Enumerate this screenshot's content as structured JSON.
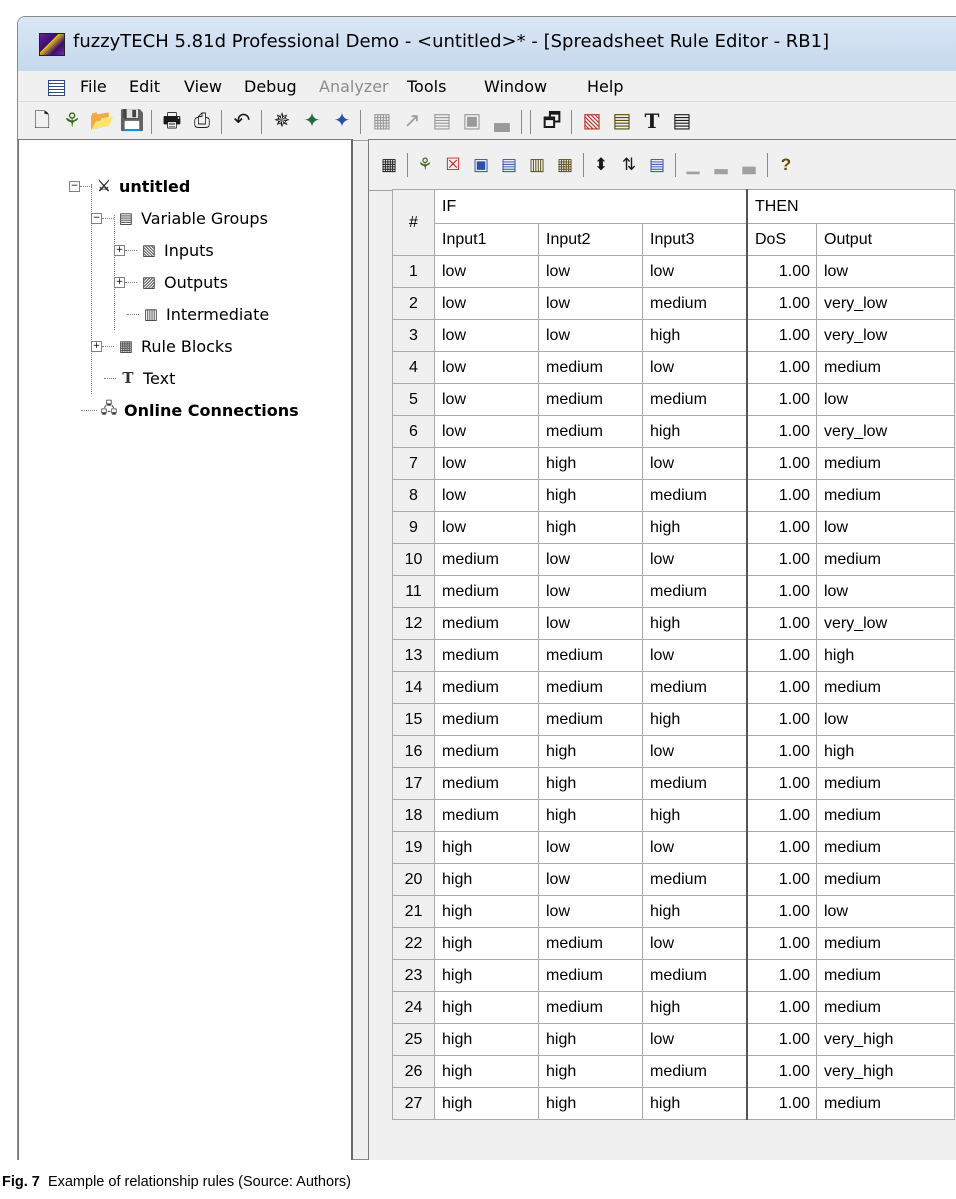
{
  "window": {
    "title": "fuzzyTECH 5.81d Professional Demo - <untitled>* - [Spreadsheet Rule Editor - RB1]"
  },
  "menu": {
    "items": [
      {
        "label": "File",
        "enabled": true
      },
      {
        "label": "Edit",
        "enabled": true
      },
      {
        "label": "View",
        "enabled": true
      },
      {
        "label": "Debug",
        "enabled": true
      },
      {
        "label": "Analyzer",
        "enabled": false
      },
      {
        "label": "Tools",
        "enabled": true
      },
      {
        "label": "Window",
        "enabled": true
      },
      {
        "label": "Help",
        "enabled": true
      }
    ]
  },
  "toolbar": {
    "icons": [
      "new-icon",
      "wizard-icon",
      "open-icon",
      "save-icon",
      "print-icon",
      "print-setup-icon",
      "undo-icon",
      "debug-icon",
      "debug-step-icon",
      "debug-run-icon",
      "analyzer-1-icon",
      "analyzer-2-icon",
      "analyzer-3-icon",
      "analyzer-4-icon",
      "analyzer-5-icon",
      "properties-icon",
      "edit-variable-icon",
      "edit-rules-icon",
      "text-icon",
      "window-icon"
    ]
  },
  "tree": {
    "root": "untitled",
    "variable_groups": "Variable Groups",
    "inputs": "Inputs",
    "outputs": "Outputs",
    "intermediate": "Intermediate",
    "rule_blocks": "Rule Blocks",
    "text": "Text",
    "online_connections": "Online Connections"
  },
  "rule_toolbar": {
    "icons": [
      "rule-block-icon",
      "wizard-icon",
      "delete-rule-icon",
      "dos-icon",
      "new-rule-icon",
      "insert-rule-icon",
      "sort-icon",
      "sort-order-icon",
      "matrix-icon",
      "chart-1-icon",
      "chart-2-icon",
      "chart-3-icon",
      "help-icon"
    ]
  },
  "rules_table": {
    "header_num": "#",
    "if_label": "IF",
    "then_label": "THEN",
    "columns": {
      "input1": "Input1",
      "input2": "Input2",
      "input3": "Input3",
      "dos": "DoS",
      "output": "Output"
    },
    "rows": [
      {
        "n": "1",
        "i1": "low",
        "i2": "low",
        "i3": "low",
        "dos": "1.00",
        "out": "low"
      },
      {
        "n": "2",
        "i1": "low",
        "i2": "low",
        "i3": "medium",
        "dos": "1.00",
        "out": "very_low"
      },
      {
        "n": "3",
        "i1": "low",
        "i2": "low",
        "i3": "high",
        "dos": "1.00",
        "out": "very_low"
      },
      {
        "n": "4",
        "i1": "low",
        "i2": "medium",
        "i3": "low",
        "dos": "1.00",
        "out": "medium"
      },
      {
        "n": "5",
        "i1": "low",
        "i2": "medium",
        "i3": "medium",
        "dos": "1.00",
        "out": "low"
      },
      {
        "n": "6",
        "i1": "low",
        "i2": "medium",
        "i3": "high",
        "dos": "1.00",
        "out": "very_low"
      },
      {
        "n": "7",
        "i1": "low",
        "i2": "high",
        "i3": "low",
        "dos": "1.00",
        "out": "medium"
      },
      {
        "n": "8",
        "i1": "low",
        "i2": "high",
        "i3": "medium",
        "dos": "1.00",
        "out": "medium"
      },
      {
        "n": "9",
        "i1": "low",
        "i2": "high",
        "i3": "high",
        "dos": "1.00",
        "out": "low"
      },
      {
        "n": "10",
        "i1": "medium",
        "i2": "low",
        "i3": "low",
        "dos": "1.00",
        "out": "medium"
      },
      {
        "n": "11",
        "i1": "medium",
        "i2": "low",
        "i3": "medium",
        "dos": "1.00",
        "out": "low"
      },
      {
        "n": "12",
        "i1": "medium",
        "i2": "low",
        "i3": "high",
        "dos": "1.00",
        "out": "very_low"
      },
      {
        "n": "13",
        "i1": "medium",
        "i2": "medium",
        "i3": "low",
        "dos": "1.00",
        "out": "high"
      },
      {
        "n": "14",
        "i1": "medium",
        "i2": "medium",
        "i3": "medium",
        "dos": "1.00",
        "out": "medium"
      },
      {
        "n": "15",
        "i1": "medium",
        "i2": "medium",
        "i3": "high",
        "dos": "1.00",
        "out": "low"
      },
      {
        "n": "16",
        "i1": "medium",
        "i2": "high",
        "i3": "low",
        "dos": "1.00",
        "out": "high"
      },
      {
        "n": "17",
        "i1": "medium",
        "i2": "high",
        "i3": "medium",
        "dos": "1.00",
        "out": "medium"
      },
      {
        "n": "18",
        "i1": "medium",
        "i2": "high",
        "i3": "high",
        "dos": "1.00",
        "out": "medium"
      },
      {
        "n": "19",
        "i1": "high",
        "i2": "low",
        "i3": "low",
        "dos": "1.00",
        "out": "medium"
      },
      {
        "n": "20",
        "i1": "high",
        "i2": "low",
        "i3": "medium",
        "dos": "1.00",
        "out": "medium"
      },
      {
        "n": "21",
        "i1": "high",
        "i2": "low",
        "i3": "high",
        "dos": "1.00",
        "out": "low"
      },
      {
        "n": "22",
        "i1": "high",
        "i2": "medium",
        "i3": "low",
        "dos": "1.00",
        "out": "medium"
      },
      {
        "n": "23",
        "i1": "high",
        "i2": "medium",
        "i3": "medium",
        "dos": "1.00",
        "out": "medium"
      },
      {
        "n": "24",
        "i1": "high",
        "i2": "medium",
        "i3": "high",
        "dos": "1.00",
        "out": "medium"
      },
      {
        "n": "25",
        "i1": "high",
        "i2": "high",
        "i3": "low",
        "dos": "1.00",
        "out": "very_high"
      },
      {
        "n": "26",
        "i1": "high",
        "i2": "high",
        "i3": "medium",
        "dos": "1.00",
        "out": "very_high"
      },
      {
        "n": "27",
        "i1": "high",
        "i2": "high",
        "i3": "high",
        "dos": "1.00",
        "out": "medium"
      }
    ]
  },
  "caption": {
    "label": "Fig. 7",
    "text": "Example of relationship rules (Source: Authors)"
  }
}
